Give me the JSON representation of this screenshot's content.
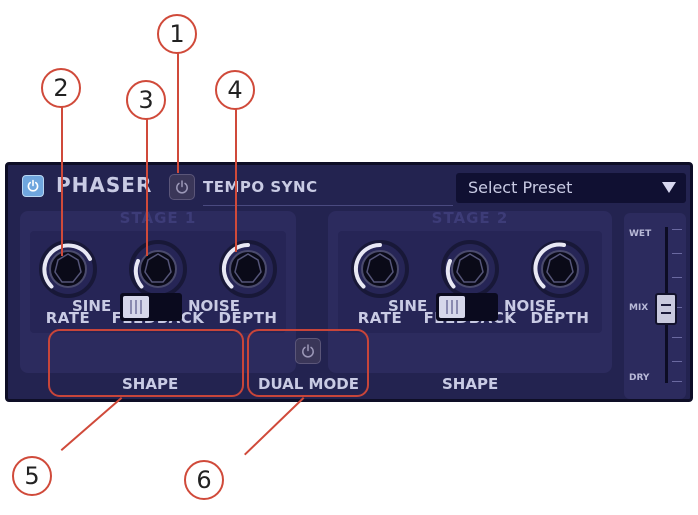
{
  "plugin": {
    "title": "PHASER",
    "tempo_sync_label": "TEMPO SYNC",
    "preset": {
      "value": "Select Preset"
    },
    "colors": {
      "panel": "#232350",
      "accent": "#6fa6de",
      "callout": "#d04a3a"
    }
  },
  "stages": [
    {
      "title": "STAGE 1",
      "knobs": [
        {
          "label": "RATE"
        },
        {
          "label": "FEEDBACK"
        },
        {
          "label": "DEPTH"
        }
      ],
      "shape_switch": {
        "left": "SINE",
        "right": "NOISE",
        "label": "SHAPE"
      }
    },
    {
      "title": "STAGE 2",
      "knobs": [
        {
          "label": "RATE"
        },
        {
          "label": "FEEDBACK"
        },
        {
          "label": "DEPTH"
        }
      ],
      "shape_switch": {
        "left": "SINE",
        "right": "NOISE",
        "label": "SHAPE"
      }
    }
  ],
  "dual_mode": {
    "label": "DUAL MODE"
  },
  "mix": {
    "top": "WET",
    "middle": "MIX",
    "bottom": "DRY"
  },
  "callouts": [
    "1",
    "2",
    "3",
    "4",
    "5",
    "6"
  ],
  "icons": {
    "power": "power-icon",
    "tempo_sync": "power-icon",
    "dual_mode": "power-icon",
    "preset_dropdown": "triangle-down-icon"
  }
}
